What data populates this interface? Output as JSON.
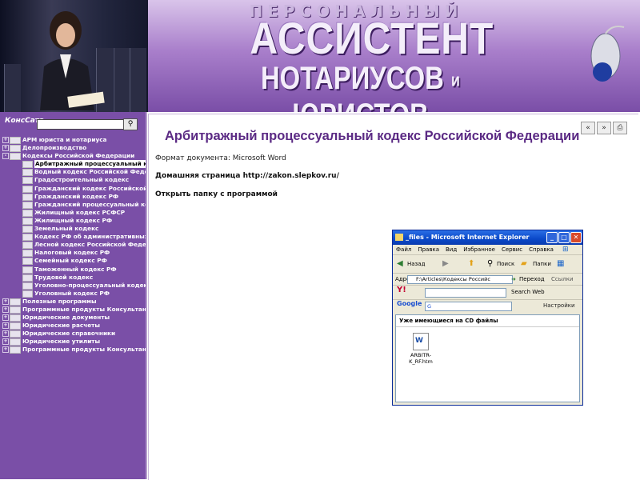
{
  "banner": {
    "line1": "ПЕРСОНАЛЬНЫЙ",
    "line2": "АССИСТЕНТ",
    "line3a": "НОТАРИУСОВ",
    "line3b": "и",
    "line3c": "ЮРИСТОВ"
  },
  "sidebar": {
    "logo": "КонсСата",
    "search_value": "",
    "search_icon": "magnifier-icon",
    "tree": [
      {
        "label": "АРМ юриста и нотариуса",
        "level": 0,
        "expander": "+"
      },
      {
        "label": "Делопроизводство",
        "level": 0,
        "expander": "+"
      },
      {
        "label": "Кодексы Российской Федерации",
        "level": 0,
        "expander": "-"
      },
      {
        "label": "Арбитражный процессуальный кодекс",
        "level": 1,
        "selected": true
      },
      {
        "label": "Водный кодекс Российской Федерации",
        "level": 1
      },
      {
        "label": "Градостроительный кодекс",
        "level": 1
      },
      {
        "label": "Гражданский кодекс Российской Федерации",
        "level": 1
      },
      {
        "label": "Гражданский кодекс РФ",
        "level": 1
      },
      {
        "label": "Гражданский процессуальный кодекс",
        "level": 1
      },
      {
        "label": "Жилищный кодекс РСФСР",
        "level": 1
      },
      {
        "label": "Жилищный кодекс РФ",
        "level": 1
      },
      {
        "label": "Земельный кодекс",
        "level": 1
      },
      {
        "label": "Кодекс РФ об административных",
        "level": 1
      },
      {
        "label": "Лесной кодекс Российской Федерации",
        "level": 1
      },
      {
        "label": "Налоговый кодекс РФ",
        "level": 1
      },
      {
        "label": "Семейный кодекс РФ",
        "level": 1
      },
      {
        "label": "Таможенный кодекс РФ",
        "level": 1
      },
      {
        "label": "Трудовой кодекс",
        "level": 1
      },
      {
        "label": "Уголовно-процессуальный кодекс",
        "level": 1
      },
      {
        "label": "Уголовный кодекс РФ",
        "level": 1
      },
      {
        "label": "Полезные программы",
        "level": 0,
        "expander": "+"
      },
      {
        "label": "Программные продукты Консультант",
        "level": 0,
        "expander": "+"
      },
      {
        "label": "Юридические документы",
        "level": 0,
        "expander": "+"
      },
      {
        "label": "Юридические расчеты",
        "level": 0,
        "expander": "+"
      },
      {
        "label": "Юридические справочники",
        "level": 0,
        "expander": "+"
      },
      {
        "label": "Юридические утилиты",
        "level": 0,
        "expander": "+"
      },
      {
        "label": "Программные продукты Консультант",
        "level": 0,
        "expander": "+"
      }
    ]
  },
  "content": {
    "nav": {
      "back": "«",
      "forward": "»",
      "print": "⎙"
    },
    "title": "Арбитражный процессуальный кодекс Российской Федерации",
    "format_label": "Формат документа:",
    "format_value": "Microsoft Word",
    "home_label": "Домашняя страница",
    "home_url": "http://zakon.slepkov.ru/",
    "open_folder": "Открыть папку с программой"
  },
  "explorer": {
    "title": "_files - Microsoft Internet Explorer",
    "menu": [
      "Файл",
      "Правка",
      "Вид",
      "Избранное",
      "Сервис",
      "Справка"
    ],
    "toolbar": {
      "back": "Назад",
      "search": "Поиск",
      "folders": "Папки"
    },
    "address_label": "Адрес:",
    "address_value": "F:\\Articles\\Кодексы Российс",
    "go_label": "Переход",
    "links_label": "Ссылки",
    "yahoo_logo": "Y!",
    "yahoo_search": "Search Web",
    "google_logo": "Google",
    "google_input": "G",
    "google_settings": "Настройки",
    "body_header": "Уже имеющиеся на CD файлы",
    "file_name": "ARBITR-K_RF.htm"
  },
  "colors": {
    "accent": "#5b2a84",
    "sidebar": "#7a4fa7",
    "xp_blue": "#0a48c8"
  }
}
